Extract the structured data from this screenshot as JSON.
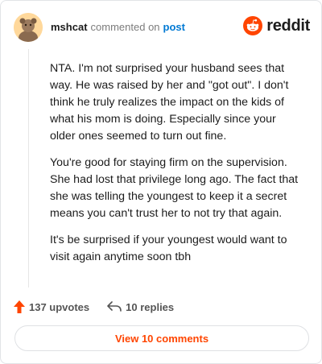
{
  "header": {
    "username": "mshcat",
    "commented_text": "commented on",
    "post_link": "post",
    "brand": "reddit"
  },
  "comment": {
    "paragraphs": [
      "NTA. I'm not surprised your husband sees that way. He was raised by her and \"got out\". I don't think he truly realizes the impact on the kids of what his mom is doing. Especially since your older ones seemed to turn out fine.",
      "You're good for staying firm on the supervision. She had lost that privilege long ago. The fact that she was telling the youngest to keep it a secret means you can't trust her to not try that again.",
      "It's be surprised if your youngest would want to visit again anytime soon tbh"
    ]
  },
  "actions": {
    "upvotes": "137 upvotes",
    "replies": "10 replies"
  },
  "footer": {
    "view_comments": "View 10 comments"
  },
  "colors": {
    "brand": "#ff4500",
    "link": "#0079d3"
  }
}
